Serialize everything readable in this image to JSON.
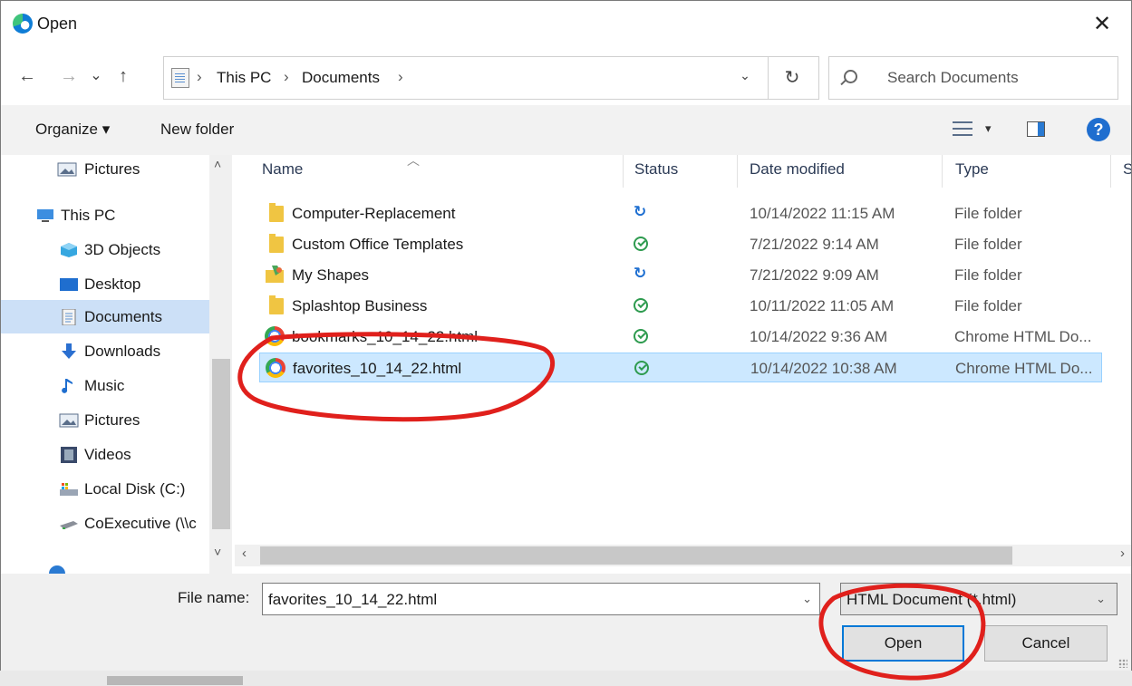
{
  "window": {
    "title": "Open",
    "close_glyph": "✕"
  },
  "nav": {
    "back_glyph": "←",
    "forward_glyph": "→",
    "recent_glyph": "⌄",
    "up_glyph": "↑",
    "breadcrumb": [
      "This PC",
      "Documents"
    ],
    "sep_glyph": "›",
    "refresh_glyph": "↻",
    "search_placeholder": "Search Documents"
  },
  "commands": {
    "organize": "Organize ▾",
    "new_folder": "New folder",
    "help": "?"
  },
  "sidebar": {
    "items": [
      {
        "label": "Pictures",
        "icon": "pictures-icon",
        "selected": false
      },
      {
        "label": "This PC",
        "icon": "pc-icon",
        "selected": false
      },
      {
        "label": "3D Objects",
        "icon": "3d-objects-icon",
        "selected": false
      },
      {
        "label": "Desktop",
        "icon": "desktop-icon",
        "selected": false
      },
      {
        "label": "Documents",
        "icon": "documents-icon",
        "selected": true
      },
      {
        "label": "Downloads",
        "icon": "downloads-icon",
        "selected": false
      },
      {
        "label": "Music",
        "icon": "music-icon",
        "selected": false
      },
      {
        "label": "Pictures",
        "icon": "pictures-icon",
        "selected": false
      },
      {
        "label": "Videos",
        "icon": "videos-icon",
        "selected": false
      },
      {
        "label": "Local Disk (C:)",
        "icon": "drive-icon",
        "selected": false
      },
      {
        "label": "CoExecutive (\\\\c",
        "icon": "network-drive-icon",
        "selected": false
      }
    ]
  },
  "columns": {
    "name": "Name",
    "status": "Status",
    "date": "Date modified",
    "type": "Type",
    "size_initial": "S"
  },
  "files": [
    {
      "name": "Computer-Replacement",
      "status": "sync",
      "date": "10/14/2022 11:15 AM",
      "type": "File folder",
      "icon": "folder-icon"
    },
    {
      "name": "Custom Office Templates",
      "status": "ok",
      "date": "7/21/2022 9:14 AM",
      "type": "File folder",
      "icon": "folder-icon"
    },
    {
      "name": "My Shapes",
      "status": "sync",
      "date": "7/21/2022 9:09 AM",
      "type": "File folder",
      "icon": "shapes-folder-icon"
    },
    {
      "name": "Splashtop Business",
      "status": "ok",
      "date": "10/11/2022 11:05 AM",
      "type": "File folder",
      "icon": "folder-icon"
    },
    {
      "name": "bookmarks_10_14_22.html",
      "status": "ok",
      "date": "10/14/2022 9:36 AM",
      "type": "Chrome HTML Do...",
      "icon": "chrome-icon"
    },
    {
      "name": "favorites_10_14_22.html",
      "status": "ok",
      "date": "10/14/2022 10:38 AM",
      "type": "Chrome HTML Do...",
      "icon": "chrome-icon",
      "selected": true
    }
  ],
  "footer": {
    "file_name_label": "File name:",
    "file_name_value": "favorites_10_14_22.html",
    "file_type_value": "HTML Document (*.html)",
    "open_label": "Open",
    "cancel_label": "Cancel"
  },
  "colors": {
    "selection": "#cce8ff",
    "annotation": "#e0201c",
    "accent": "#0078d7"
  }
}
